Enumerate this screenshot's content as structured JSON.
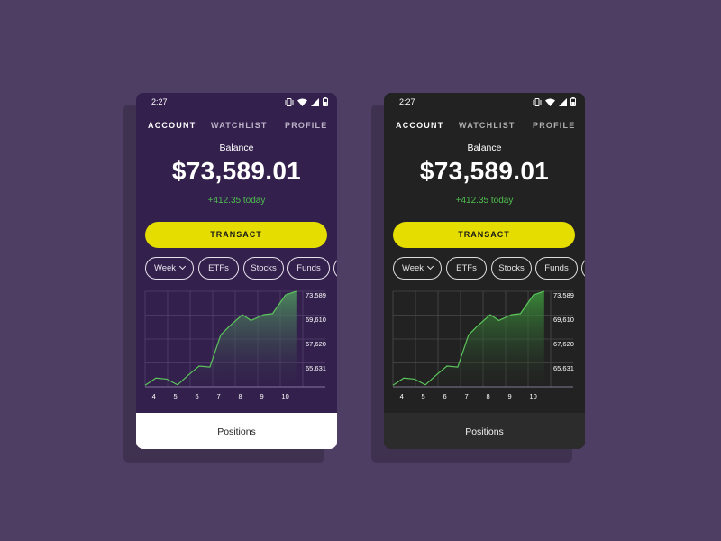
{
  "status_bar": {
    "time": "2:27",
    "icons": [
      "vibrate-icon",
      "wifi-icon",
      "signal-icon",
      "battery-icon"
    ]
  },
  "tabs": [
    {
      "label": "ACCOUNT",
      "active": true
    },
    {
      "label": "WATCHLIST",
      "active": false
    },
    {
      "label": "PROFILE",
      "active": false
    }
  ],
  "balance": {
    "label": "Balance",
    "value": "$73,589.01",
    "change": "+412.35 today"
  },
  "transact_label": "TRANSACT",
  "filters": [
    {
      "label": "Week",
      "dropdown": true
    },
    {
      "label": "ETFs"
    },
    {
      "label": "Stocks"
    },
    {
      "label": "Funds"
    },
    {
      "label": ""
    }
  ],
  "positions_label": "Positions",
  "colors": {
    "background": "#4f3e63",
    "purple_theme": "#33204c",
    "dark_theme": "#222222",
    "accent": "#e5dc00",
    "positive": "#4fbf4f"
  },
  "chart_data": {
    "type": "area",
    "x_ticks": [
      "4",
      "5",
      "6",
      "7",
      "8",
      "9",
      "10"
    ],
    "y_ticks": [
      "73,589",
      "69,610",
      "67,620",
      "65,631"
    ],
    "x": [
      3.6,
      4.1,
      4.6,
      5.1,
      5.6,
      6.1,
      6.6,
      7.1,
      7.5,
      8.1,
      8.5,
      9.1,
      9.5,
      10.1,
      10.6
    ],
    "y": [
      63800,
      64550,
      64450,
      63850,
      64850,
      65800,
      65700,
      69050,
      69950,
      71150,
      70550,
      71150,
      71250,
      73200,
      73600
    ],
    "ylim": [
      63641,
      73589
    ],
    "grid": true
  }
}
